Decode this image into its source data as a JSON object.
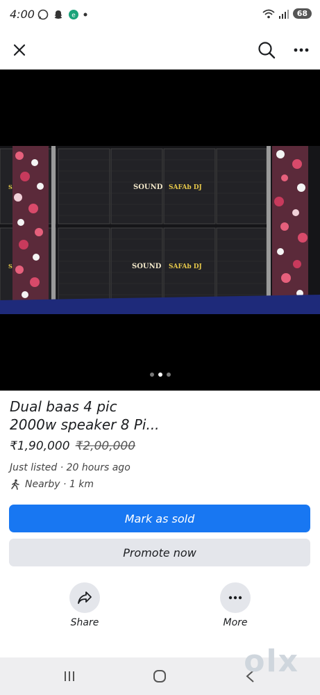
{
  "status": {
    "time": "4:00",
    "battery": "68"
  },
  "listing": {
    "title_line1": "Dual baas 4 pic",
    "title_line2": "2000w speaker 8 Pi...",
    "price": "₹1,90,000",
    "old_price": "₹2,00,000",
    "listed": "Just listed · 20 hours ago",
    "location": "Nearby · 1 km"
  },
  "photo": {
    "sign_text": "SOUND",
    "brand_text": "SAFAb DJ",
    "side_text": "SAF"
  },
  "carousel": {
    "count": 3,
    "active": 1
  },
  "buttons": {
    "mark_sold": "Mark as sold",
    "promote": "Promote now"
  },
  "actions": {
    "share": "Share",
    "more": "More"
  },
  "watermark": "olx",
  "colors": {
    "primary": "#1877f2",
    "secondary": "#e4e6eb",
    "hero_bg": "#000000"
  }
}
